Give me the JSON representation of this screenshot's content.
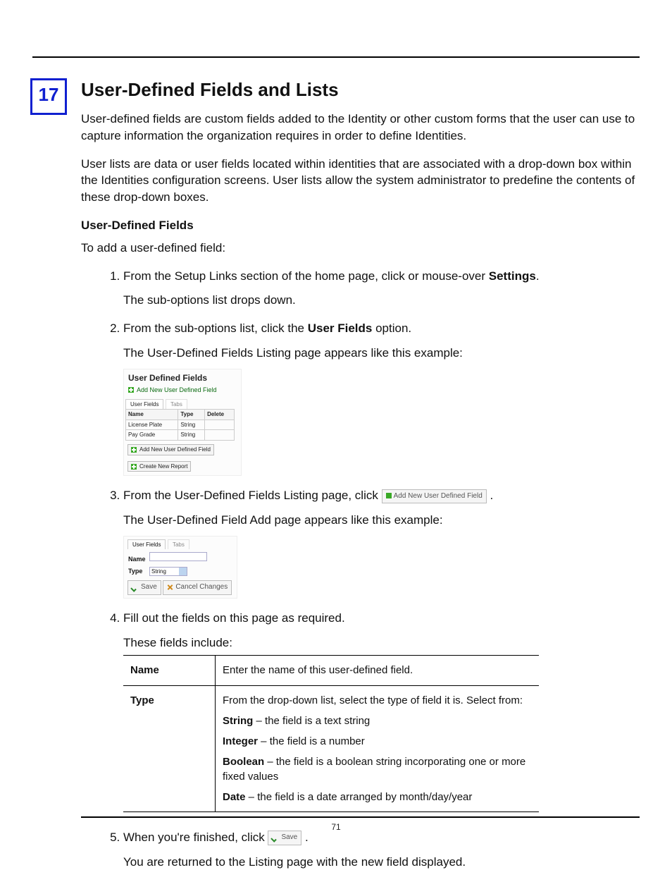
{
  "chapter_number": "17",
  "title": "User-Defined Fields and Lists",
  "intro1": "User-defined fields are custom fields added to the Identity or other custom forms that the user can use to capture information the organization requires in order to define Identities.",
  "intro2": "User lists are data or user fields located within identities that are associated with a drop-down box within the Identities configuration screens. User lists allow the system administrator to predefine the contents of these drop-down boxes.",
  "section": "User-Defined Fields",
  "lead": "To add a user-defined field:",
  "steps": {
    "s1a": "From the Setup Links section of the home page, click or mouse-over ",
    "s1b": "Settings",
    "s1c": ".",
    "s1d": "The sub-options list drops down.",
    "s2a": "From the sub-options list, click the ",
    "s2b": "User Fields",
    "s2c": " option.",
    "s2d": "The User-Defined Fields Listing page appears like this example:",
    "s3a": "From the User-Defined Fields Listing page, click ",
    "s3b": ".",
    "s3c": "The User-Defined Field Add page appears like this example:",
    "s4a": "Fill out the fields on this page as required.",
    "s4b": "These fields include:",
    "s5a": "When you're finished, click ",
    "s5b": ".",
    "s5c": "You are returned to the Listing page with the new field displayed."
  },
  "fig1": {
    "title": "User Defined Fields",
    "add": "Add New User Defined Field",
    "tab1": "User Fields",
    "tab2": "Tabs",
    "cols": {
      "name": "Name",
      "type": "Type",
      "del": "Delete"
    },
    "rows": [
      {
        "name": "License Plate",
        "type": "String"
      },
      {
        "name": "Pay Grade",
        "type": "String"
      }
    ],
    "foot_add": "Add New User Defined Field",
    "foot_report": "Create New Report"
  },
  "inline_add": "Add New User Defined Field",
  "fig2": {
    "tab1": "User Fields",
    "tab2": "Tabs",
    "name_label": "Name",
    "type_label": "Type",
    "type_value": "String",
    "save": "Save",
    "cancel": "Cancel Changes"
  },
  "def": {
    "name_k": "Name",
    "name_v": "Enter the name of this user-defined field.",
    "type_k": "Type",
    "type_intro": "From the drop-down list, select the type of field it is. Select from:",
    "type_string_b": "String",
    "type_string_t": " – the field is a text string",
    "type_int_b": "Integer",
    "type_int_t": " – the field is a number",
    "type_bool_b": "Boolean",
    "type_bool_t": " – the field is a boolean string incorporating one or more fixed values",
    "type_date_b": "Date",
    "type_date_t": " – the field is a date arranged by month/day/year"
  },
  "inline_save": "Save",
  "page_number": "71"
}
